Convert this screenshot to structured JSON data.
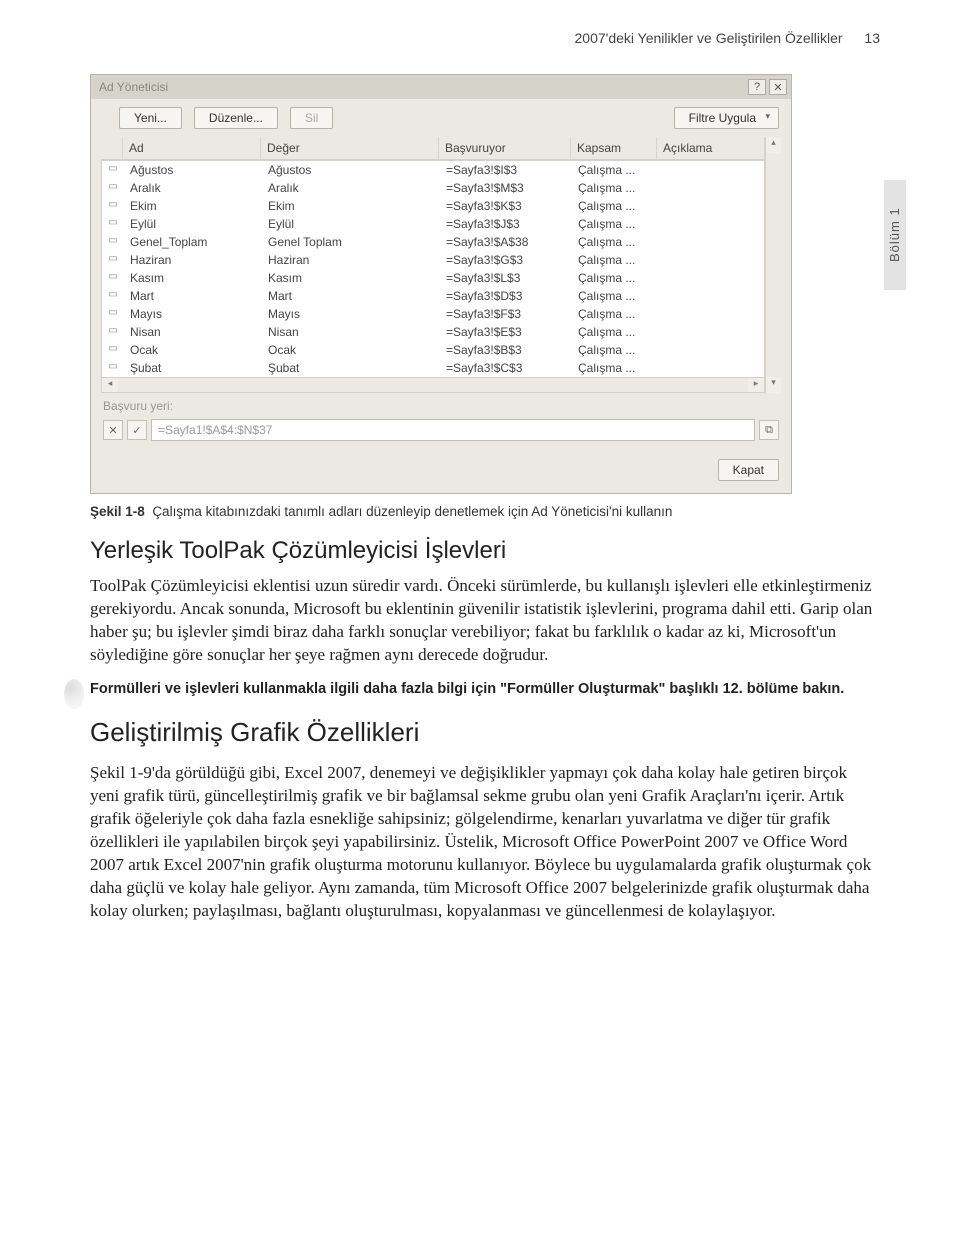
{
  "header": {
    "title": "2007'deki Yenilikler ve Geliştirilen Özellikler",
    "page": "13"
  },
  "side_tab": "Bölüm 1",
  "dialog": {
    "title": "Ad Yöneticisi",
    "help_icon": "?",
    "close_icon": "✕",
    "btn_new": "Yeni...",
    "btn_edit": "Düzenle...",
    "btn_delete": "Sil",
    "btn_filter": "Filtre Uygula",
    "col_name": "Ad",
    "col_value": "Değer",
    "col_ref": "Başvuruyor",
    "col_scope": "Kapsam",
    "col_desc": "Açıklama",
    "rows": [
      {
        "name": "Ağustos",
        "value": "Ağustos",
        "ref": "=Sayfa3!$I$3",
        "scope": "Çalışma ..."
      },
      {
        "name": "Aralık",
        "value": "Aralık",
        "ref": "=Sayfa3!$M$3",
        "scope": "Çalışma ..."
      },
      {
        "name": "Ekim",
        "value": "Ekim",
        "ref": "=Sayfa3!$K$3",
        "scope": "Çalışma ..."
      },
      {
        "name": "Eylül",
        "value": "Eylül",
        "ref": "=Sayfa3!$J$3",
        "scope": "Çalışma ..."
      },
      {
        "name": "Genel_Toplam",
        "value": "Genel Toplam",
        "ref": "=Sayfa3!$A$38",
        "scope": "Çalışma ..."
      },
      {
        "name": "Haziran",
        "value": "Haziran",
        "ref": "=Sayfa3!$G$3",
        "scope": "Çalışma ..."
      },
      {
        "name": "Kasım",
        "value": "Kasım",
        "ref": "=Sayfa3!$L$3",
        "scope": "Çalışma ..."
      },
      {
        "name": "Mart",
        "value": "Mart",
        "ref": "=Sayfa3!$D$3",
        "scope": "Çalışma ..."
      },
      {
        "name": "Mayıs",
        "value": "Mayıs",
        "ref": "=Sayfa3!$F$3",
        "scope": "Çalışma ..."
      },
      {
        "name": "Nisan",
        "value": "Nisan",
        "ref": "=Sayfa3!$E$3",
        "scope": "Çalışma ..."
      },
      {
        "name": "Ocak",
        "value": "Ocak",
        "ref": "=Sayfa3!$B$3",
        "scope": "Çalışma ..."
      },
      {
        "name": "Şubat",
        "value": "Şubat",
        "ref": "=Sayfa3!$C$3",
        "scope": "Çalışma ..."
      }
    ],
    "ref_label": "Başvuru yeri:",
    "ref_value": "=Sayfa1!$A$4:$N$37",
    "btn_close": "Kapat"
  },
  "caption": {
    "label": "Şekil 1-8",
    "text": "Çalışma kitabınızdaki tanımlı adları düzenleyip denetlemek için Ad Yöneticisi'ni kullanın"
  },
  "section1": {
    "heading": "Yerleşik ToolPak Çözümleyicisi İşlevleri",
    "p1": "ToolPak Çözümleyicisi eklentisi uzun süredir vardı. Önceki sürümlerde, bu kullanışlı işlevleri elle etkinleştirmeniz gerekiyordu. Ancak sonunda, Microsoft bu eklentinin güvenilir istatistik işlevlerini, programa dahil etti. Garip olan haber şu; bu işlevler şimdi biraz daha farklı sonuçlar verebiliyor; fakat bu farklılık o kadar az ki, Microsoft'un söylediğine göre sonuçlar her şeye rağmen aynı derecede doğrudur.",
    "note": "Formülleri ve işlevleri kullanmakla ilgili daha fazla bilgi için \"Formüller Oluşturmak\" başlıklı 12. bölüme bakın."
  },
  "section2": {
    "heading": "Geliştirilmiş Grafik Özellikleri",
    "p1": "Şekil 1-9'da görüldüğü gibi, Excel 2007, denemeyi ve değişiklikler yapmayı çok daha kolay hale getiren birçok yeni grafik türü, güncelleştirilmiş grafik ve bir bağlamsal sekme grubu olan yeni Grafik Araçları'nı içerir. Artık grafik öğeleriyle çok daha fazla esnekliğe sahipsiniz; gölgelendirme, kenarları yuvarlatma ve diğer tür grafik özellikleri ile yapılabilen birçok şeyi yapabilirsiniz. Üstelik, Microsoft Office PowerPoint 2007 ve Office Word 2007 artık Excel 2007'nin grafik oluşturma motorunu kullanıyor. Böylece bu uygulamalarda grafik oluşturmak çok daha güçlü ve kolay hale geliyor. Aynı zamanda, tüm Microsoft Office 2007 belgelerinizde grafik oluşturmak daha kolay olurken; paylaşılması, bağlantı oluşturulması, kopyalanması ve güncellenmesi de kolaylaşıyor."
  }
}
